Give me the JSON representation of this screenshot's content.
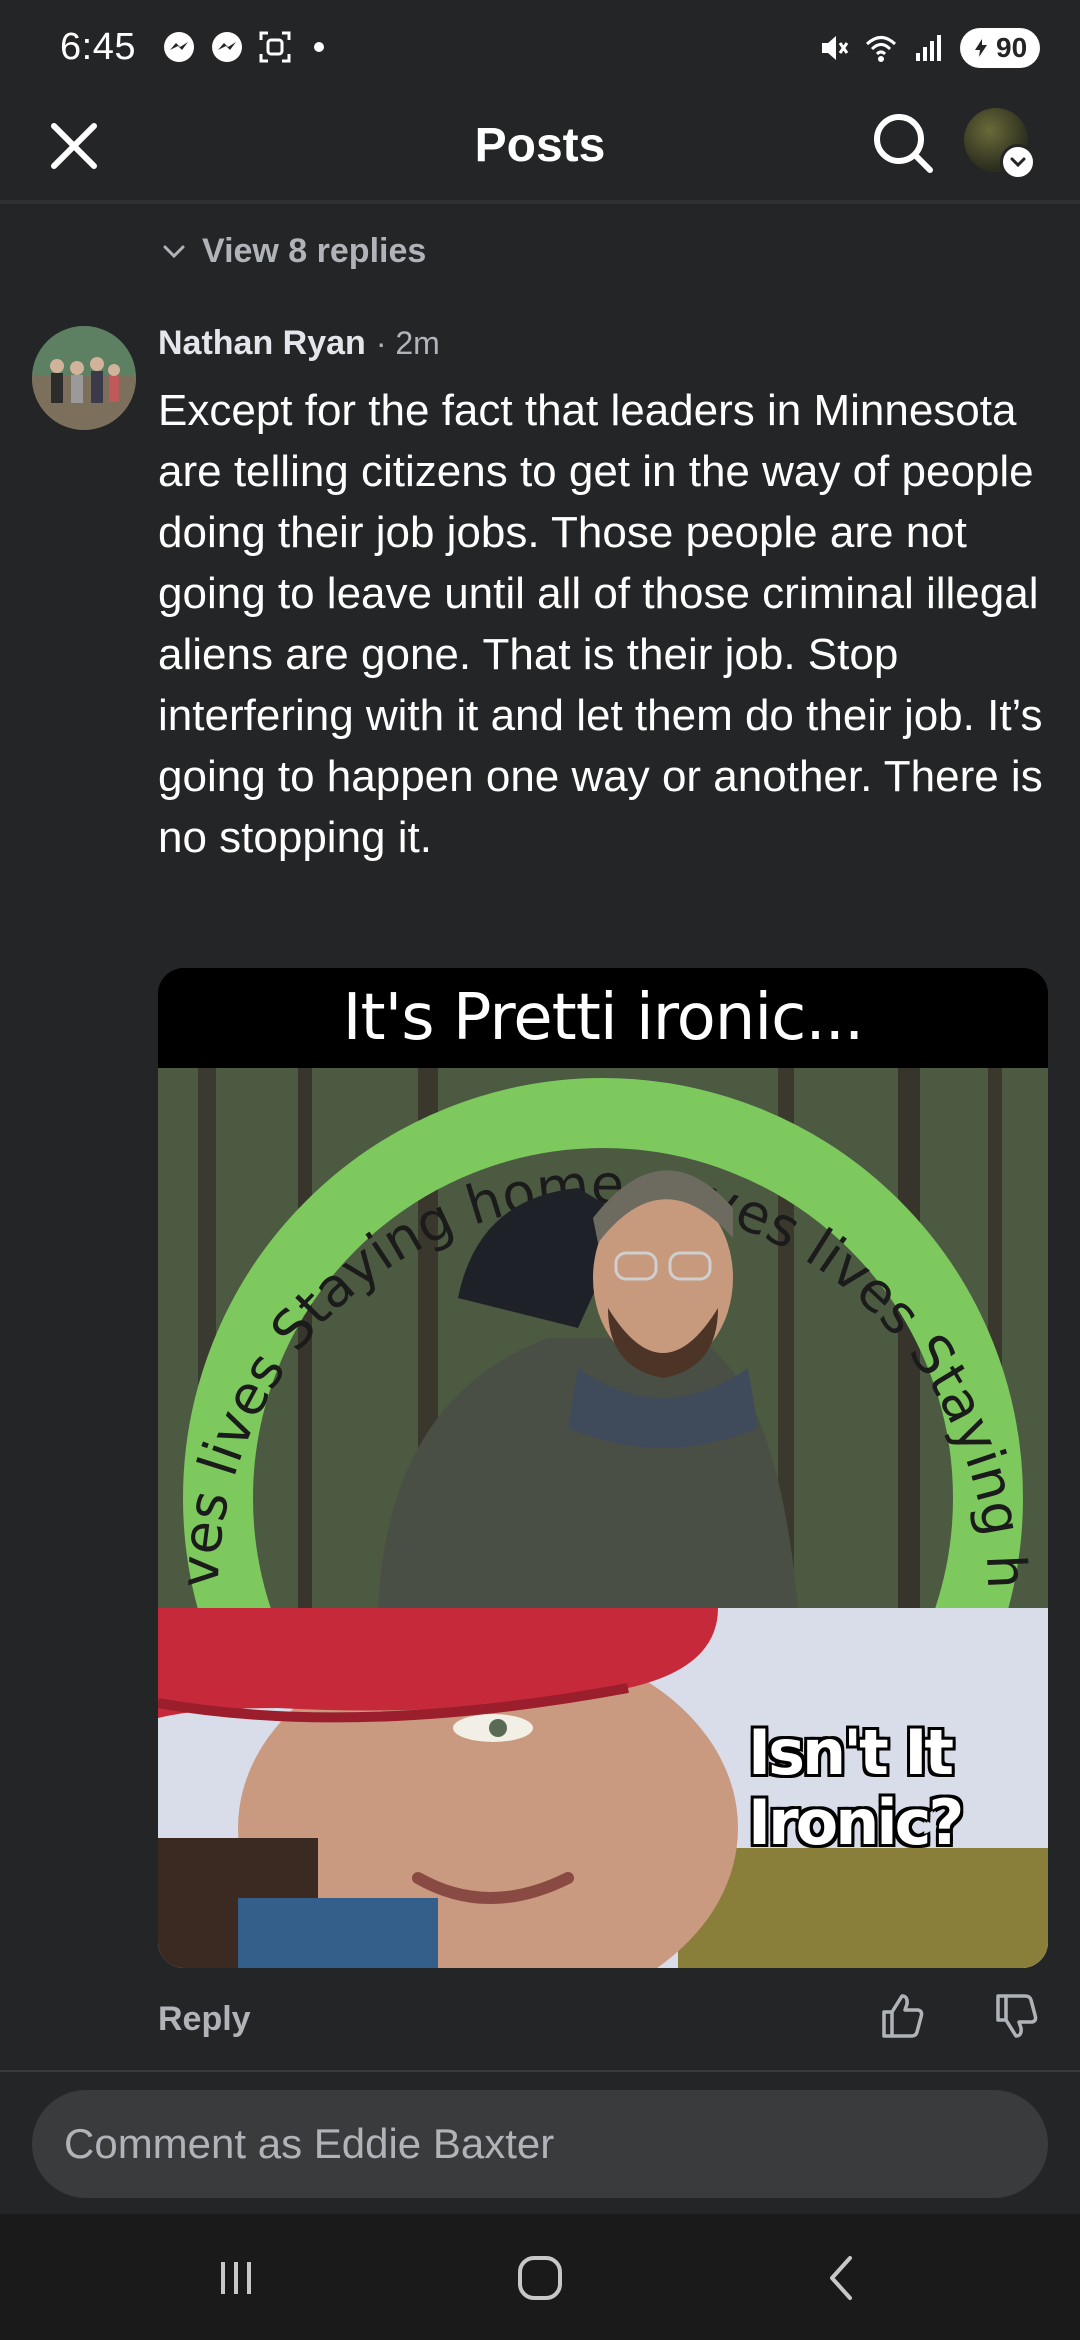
{
  "status_bar": {
    "time": "6:45",
    "battery": "90",
    "left_icons": [
      "messenger-icon",
      "messenger-icon",
      "screenshot-icon",
      "notification-dot"
    ],
    "right_icons": [
      "mute-icon",
      "wifi-icon",
      "signal-icon",
      "battery-icon"
    ]
  },
  "app_bar": {
    "title": "Posts",
    "close_icon": "close-icon",
    "search_icon": "search-icon"
  },
  "thread": {
    "view_replies_label": "View 8 replies"
  },
  "comment": {
    "author": "Nathan Ryan",
    "time": "· 2m",
    "text": "Except for the fact that leaders in Minnesota are telling citizens to get in the way of people doing their job jobs. Those people are not going to leave until all of those criminal illegal aliens are gone. That is their job. Stop interfering with it and let them do their job. It’s going to happen one way or another. There is no stopping it.",
    "reply_label": "Reply",
    "meme": {
      "caption": "It's Pretti ironic...",
      "ring_text": "ves lives Staying home saves lives Staying h",
      "bottom_text_line1": "Isn't It",
      "bottom_text_line2": "Ironic?"
    }
  },
  "composer": {
    "placeholder": "Comment as Eddie Baxter"
  },
  "colors": {
    "background": "#242526",
    "text_primary": "#e4e6eb",
    "text_secondary": "#b0b3b8",
    "input_bg": "#3a3b3c",
    "ring_green": "#7dc95e"
  }
}
